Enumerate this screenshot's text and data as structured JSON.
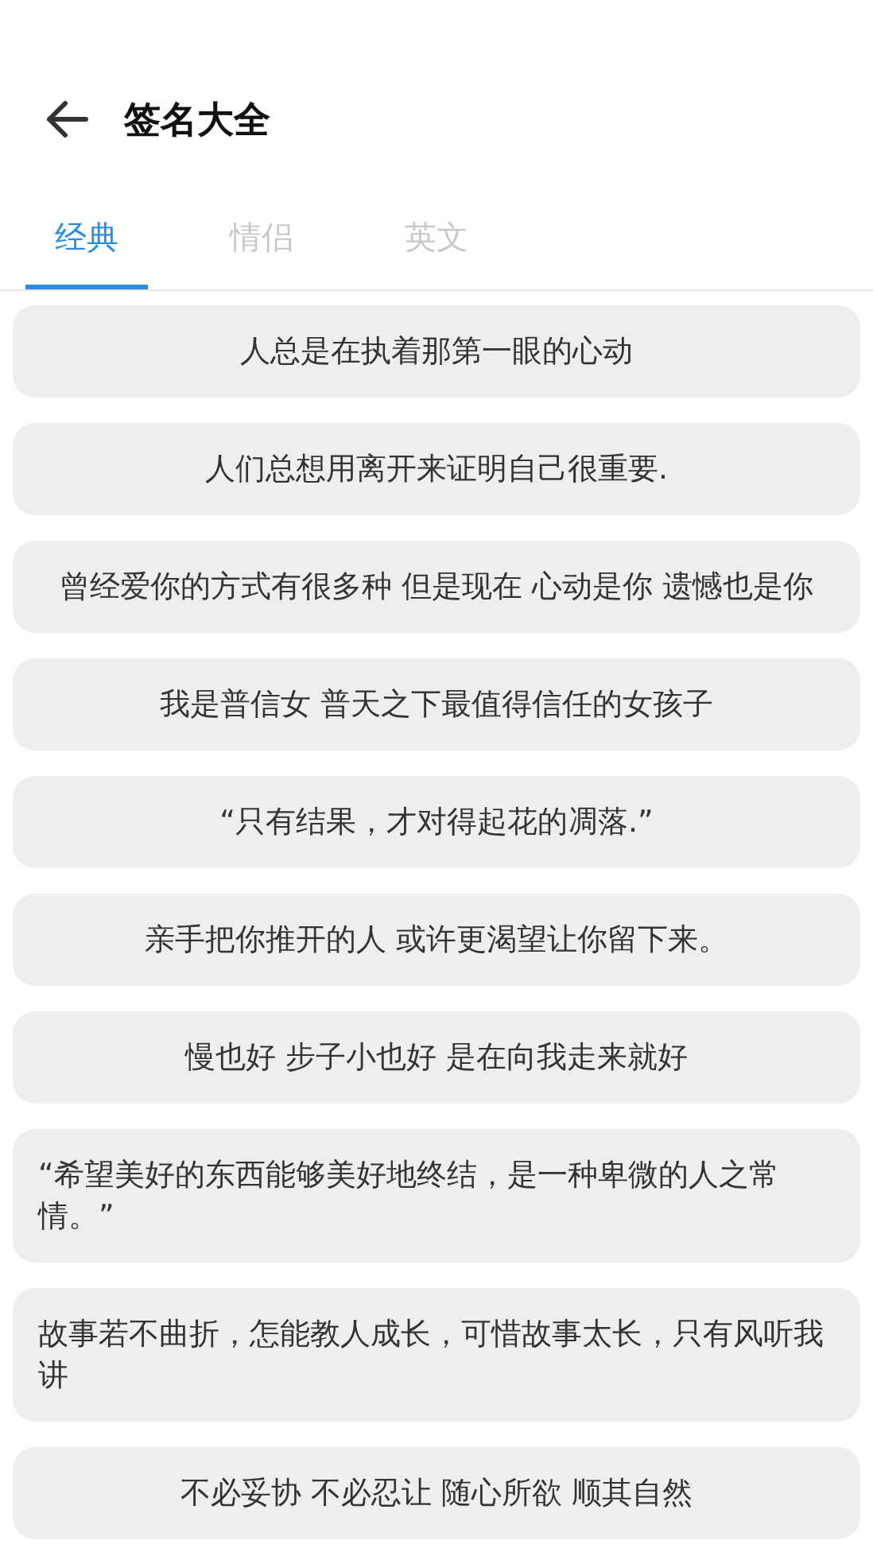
{
  "header": {
    "title": "签名大全"
  },
  "tabs": [
    {
      "label": "经典",
      "selected": true
    },
    {
      "label": "情侣",
      "selected": false
    },
    {
      "label": "英文",
      "selected": false
    }
  ],
  "signatures": [
    "人总是在执着那第一眼的心动",
    "人们总想用离开来证明自己很重要.",
    "曾经爱你的方式有很多种 但是现在 心动是你 遗憾也是你",
    "我是普信女 普天之下最值得信任的女孩子",
    "“只有结果，才对得起花的凋落.”",
    "亲手把你推开的人 或许更渴望让你留下来。",
    "慢也好 步子小也好 是在向我走来就好",
    "“希望美好的东西能够美好地终结，是一种卑微的人之常情。”",
    "故事若不曲折，怎能教人成长，可惜故事太长，只有风听我讲",
    "不必妥协 不必忍让 随心所欲 顺其自然"
  ]
}
